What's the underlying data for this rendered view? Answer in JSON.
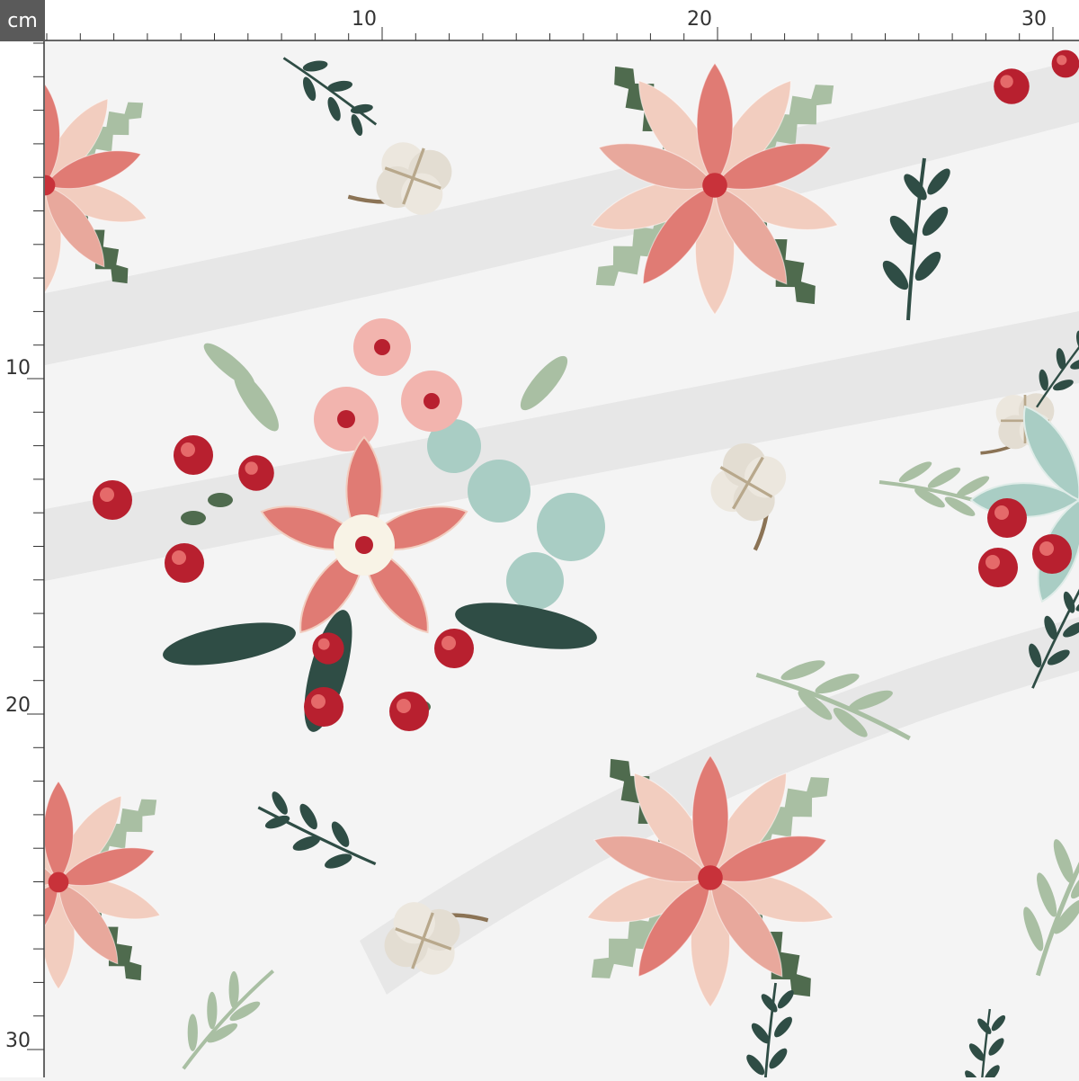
{
  "ruler": {
    "unit": "cm",
    "top_labels": [
      "10",
      "20",
      "30"
    ],
    "left_labels": [
      "10",
      "20",
      "30"
    ]
  },
  "colors": {
    "ruler_box": "#5a5a5a",
    "fabric_bg": "#f4f4f4",
    "poinsettia_coral": "#e07b74",
    "poinsettia_blush": "#f2cdbf",
    "holly_dark": "#4f6b4e",
    "sage": "#a9bfa3",
    "eucalyptus": "#a9cdc4",
    "berry_red": "#b8202f",
    "dark_leaf": "#2f4d45",
    "cotton": "#ece7de"
  },
  "pattern": {
    "motifs": [
      "poinsettia-icon",
      "bouquet-icon",
      "cotton-boll-icon",
      "sprig-icon",
      "berry-icon"
    ]
  }
}
